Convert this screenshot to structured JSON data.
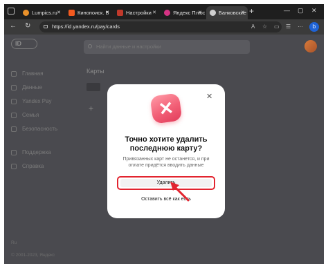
{
  "browser": {
    "tabs": [
      {
        "label": "Lumpics.ru",
        "favicon_color": "#e8902a"
      },
      {
        "label": "Кинопоиск. В",
        "favicon_color": "#f35a1f"
      },
      {
        "label": "Настройки",
        "favicon_color": "#c0392b"
      },
      {
        "label": "Яндекс Плюс",
        "favicon_color": "#d63384"
      },
      {
        "label": "Банковские и",
        "favicon_color": "#d0d0d0"
      }
    ],
    "new_tab": "+",
    "url": "https://id.yandex.ru/pay/cards",
    "profile_letter": "b"
  },
  "page": {
    "logo": "ID",
    "search_placeholder": "Найти данные и настройки",
    "sidebar": [
      {
        "label": "Главная",
        "icon": "home-icon"
      },
      {
        "label": "Данные",
        "icon": "data-icon"
      },
      {
        "label": "Yandex Pay",
        "icon": "card-icon"
      },
      {
        "label": "Семья",
        "icon": "family-icon"
      },
      {
        "label": "Безопасность",
        "icon": "shield-icon"
      },
      {
        "label": "Поддержка",
        "icon": "support-icon"
      },
      {
        "label": "Справка",
        "icon": "help-icon"
      }
    ],
    "content_title": "Карты",
    "footer_lang": "Ru",
    "footer_copyright": "© 2001-2023, Яндекс"
  },
  "modal": {
    "title_line1": "Точно хотите удалить",
    "title_line2": "последнюю карту?",
    "text_line1": "Привязанных карт не останется, и при",
    "text_line2": "оплате придётся вводить данные",
    "delete_label": "Удалить",
    "keep_label": "Оставить всё как есть",
    "icon": "delete-x-icon"
  },
  "colors": {
    "accent": "#e2242f",
    "icon_gradient": "#f25f76"
  }
}
